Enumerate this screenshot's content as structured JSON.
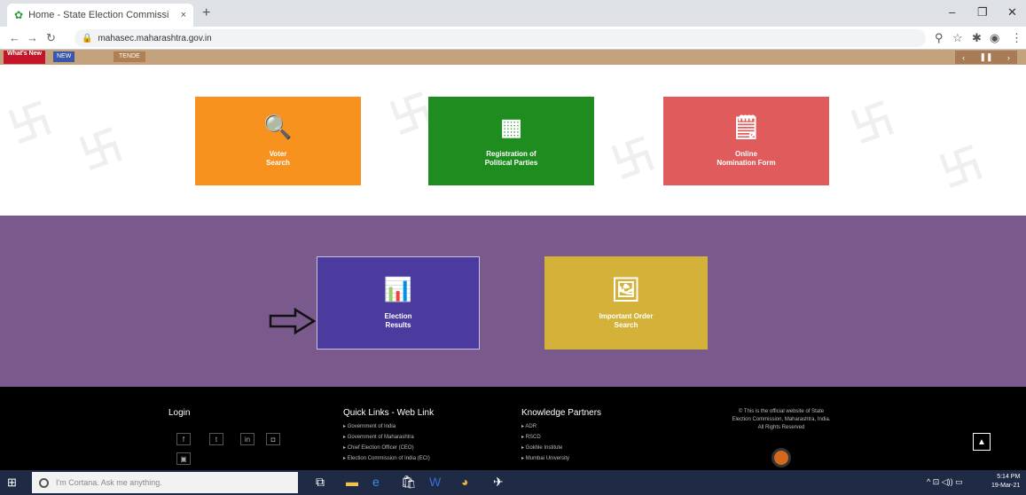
{
  "browser": {
    "tab_title": "Home - State Election Commissi",
    "tab_close": "×",
    "new_tab": "+",
    "url": "mahasec.maharashtra.gov.in"
  },
  "ticker": {
    "whats_new": "What's New",
    "new_badge": "NEW",
    "item": "TENDE"
  },
  "tiles_top": [
    {
      "line1": "Voter",
      "line2": "Search",
      "color": "#f7921e"
    },
    {
      "line1": "Registration of",
      "line2": "Political Parties",
      "color": "#1e8c1e"
    },
    {
      "line1": "Online",
      "line2": "Nomination Form",
      "color": "#e05c5c"
    }
  ],
  "tiles_band": [
    {
      "line1": "Election",
      "line2": "Results",
      "color": "#4b3b9e"
    },
    {
      "line1": "Important Order",
      "line2": "Search",
      "color": "#d4b23a"
    }
  ],
  "footer": {
    "login": "Login",
    "quick_links_title": "Quick Links - Web Link",
    "quick_links": [
      "Government of India",
      "Government of Maharashtra",
      "Chief Election Officer (CEO)",
      "Election Commission of India (ECI)"
    ],
    "partners_title": "Knowledge Partners",
    "partners": [
      "ADR",
      "RSCD",
      "Gokhle Institute",
      "Mumbai University"
    ],
    "copyright_line1": "© This is the official website of State",
    "copyright_line2": "Election Commission, Maharashtra, India.",
    "copyright_line3": "All Rights Reserved"
  },
  "taskbar": {
    "search_placeholder": "I'm Cortana. Ask me anything.",
    "time": "5:14 PM",
    "date": "19-Mar-21"
  }
}
